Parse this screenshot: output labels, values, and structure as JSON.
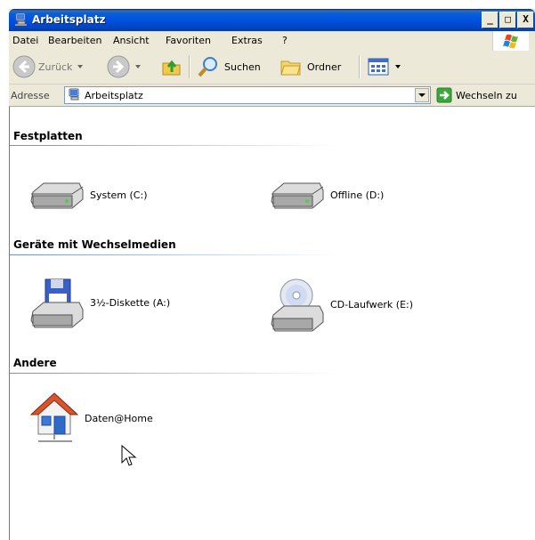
{
  "window": {
    "title": "Arbeitsplatz",
    "controls": {
      "minimize": "_",
      "maximize": "□",
      "close": "X"
    }
  },
  "menubar": {
    "items": [
      "Datei",
      "Bearbeiten",
      "Ansicht",
      "Favoriten",
      "Extras",
      "?"
    ]
  },
  "toolbar": {
    "back_label": "Zurück",
    "search_label": "Suchen",
    "folders_label": "Ordner"
  },
  "addressbar": {
    "label": "Adresse",
    "value": "Arbeitsplatz",
    "go_label": "Wechseln zu"
  },
  "groups": [
    {
      "title": "Festplatten",
      "items": [
        {
          "label": "System (C:)",
          "icon": "hard-drive-icon"
        },
        {
          "label": "Offline (D:)",
          "icon": "hard-drive-icon"
        }
      ]
    },
    {
      "title": "Geräte mit Wechselmedien",
      "items": [
        {
          "label": "3½-Diskette (A:)",
          "icon": "floppy-drive-icon"
        },
        {
          "label": "CD-Laufwerk (E:)",
          "icon": "cd-drive-icon"
        }
      ]
    },
    {
      "title": "Andere",
      "items": [
        {
          "label": "Daten@Home",
          "icon": "network-home-icon"
        }
      ]
    }
  ],
  "colors": {
    "titlebar": "#0054e3",
    "chrome": "#ece9d8",
    "group_line": "#6d8fce"
  }
}
